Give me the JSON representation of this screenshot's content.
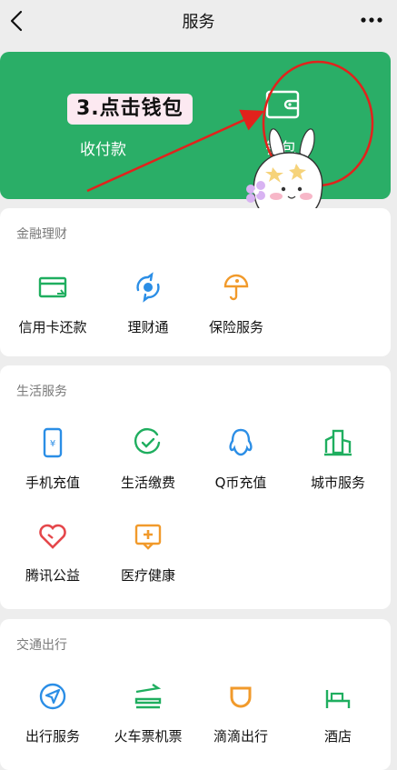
{
  "header": {
    "title": "服务"
  },
  "wallet_card": {
    "annotation": "3.点击钱包",
    "pay_label": "收付款",
    "wallet_label": "钱包",
    "accent": "#2aae67"
  },
  "sections": {
    "finance": {
      "title": "金融理财",
      "items": [
        {
          "label": "信用卡还款",
          "icon": "credit-card-icon"
        },
        {
          "label": "理财通",
          "icon": "wealth-icon"
        },
        {
          "label": "保险服务",
          "icon": "insurance-icon"
        }
      ]
    },
    "life": {
      "title": "生活服务",
      "items": [
        {
          "label": "手机充值",
          "icon": "phone-topup-icon"
        },
        {
          "label": "生活缴费",
          "icon": "bill-pay-icon"
        },
        {
          "label": "Q币充值",
          "icon": "qq-coin-icon"
        },
        {
          "label": "城市服务",
          "icon": "city-service-icon"
        },
        {
          "label": "腾讯公益",
          "icon": "charity-icon"
        },
        {
          "label": "医疗健康",
          "icon": "medical-icon"
        }
      ]
    },
    "travel": {
      "title": "交通出行",
      "items": [
        {
          "label": "出行服务",
          "icon": "travel-icon"
        },
        {
          "label": "火车票机票",
          "icon": "train-plane-icon"
        },
        {
          "label": "滴滴出行",
          "icon": "didi-icon"
        },
        {
          "label": "酒店",
          "icon": "hotel-icon"
        }
      ]
    }
  }
}
